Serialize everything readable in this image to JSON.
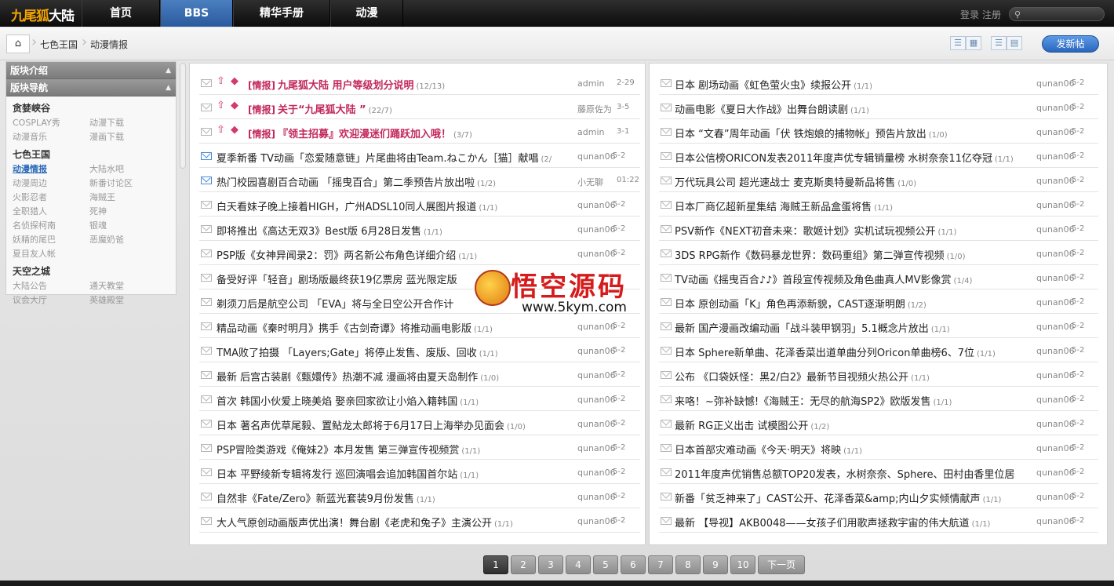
{
  "header": {
    "logo_a": "九尾狐",
    "logo_b": "大陆",
    "nav": [
      "首页",
      "BBS",
      "精华手册",
      "动漫"
    ],
    "login": "登录",
    "register": "注册",
    "search_placeholder": ""
  },
  "breadcrumb": {
    "home_icon": "home-icon",
    "items": [
      "七色王国",
      "动漫情报"
    ],
    "post_button": "发新帖"
  },
  "sidebar": {
    "intro_title": "版块介绍",
    "nav_title": "版块导航",
    "groups": [
      {
        "title": "贪婪峡谷",
        "items": [
          "COSPLAY秀",
          "动漫下载",
          "动漫音乐",
          "漫画下载"
        ]
      },
      {
        "title": "七色王国",
        "items": [
          "动漫情报",
          "大陆水吧",
          "动漫周边",
          "新番讨论区",
          "火影忍者",
          "海贼王",
          "全职猎人",
          "死神",
          "名侦探柯南",
          "银魂",
          "妖精的尾巴",
          "恶魔奶爸",
          "夏目友人帐"
        ]
      },
      {
        "title": "天空之城",
        "items": [
          "大陆公告",
          "通天教堂",
          "议会大厅",
          "英雄殿堂"
        ]
      }
    ]
  },
  "threads_left": [
    {
      "prefix": "[情报]",
      "title": "九尾狐大陆 用户等级划分说明",
      "count": "(12/13)",
      "author": "admin",
      "date": "2-29",
      "hot": true
    },
    {
      "prefix": "[情报]",
      "title": "关于“九尾狐大陆 ”",
      "count": "(22/7)",
      "author": "藤原佐为",
      "date": "3-5",
      "hot": true
    },
    {
      "prefix": "[情报]",
      "title": "『领主招募』欢迎漫迷们踊跃加入哦！",
      "count": "(3/7)",
      "author": "admin",
      "date": "3-1",
      "hot": true
    },
    {
      "prefix": "",
      "title": "夏季新番 TV动画「恋爱随意链」片尾曲将由Team.ねこかん［猫］献唱",
      "count": "(2/",
      "author": "qunan06",
      "date": "5-2",
      "hot": false
    },
    {
      "prefix": "",
      "title": "热门校园喜剧百合动画 「摇曳百合」第二季预告片放出啦",
      "count": "(1/2)",
      "author": "小无聊",
      "date": "01:22",
      "hot": false
    },
    {
      "prefix": "",
      "title": "白天看妹子晚上接着HIGH，广州ADSL10同人展图片报道",
      "count": "(1/1)",
      "author": "qunan06",
      "date": "5-2",
      "hot": false
    },
    {
      "prefix": "",
      "title": "即将推出《高达无双3》Best版 6月28日发售",
      "count": "(1/1)",
      "author": "qunan06",
      "date": "5-2",
      "hot": false
    },
    {
      "prefix": "",
      "title": "PSP版《女神异闻录2：罚》两名新公布角色详细介绍",
      "count": "(1/1)",
      "author": "qunan06",
      "date": "5-2",
      "hot": false
    },
    {
      "prefix": "",
      "title": "备受好评「轻音」剧场版最终获19亿票房 蓝光限定版",
      "count": "",
      "author": "",
      "date": "",
      "hot": false
    },
    {
      "prefix": "",
      "title": "剃须刀后是航空公司 「EVA」将与全日空公开合作计",
      "count": "",
      "author": "",
      "date": "",
      "hot": false
    },
    {
      "prefix": "",
      "title": "精品动画《秦时明月》携手《古剑奇谭》将推动画电影版",
      "count": "(1/1)",
      "author": "qunan06",
      "date": "5-2",
      "hot": false
    },
    {
      "prefix": "",
      "title": "TMA败了拍摄 「Layers;Gate」将停止发售、废版、回收",
      "count": "(1/1)",
      "author": "qunan06",
      "date": "5-2",
      "hot": false
    },
    {
      "prefix": "",
      "title": "最新 后宫古装剧《甄嬛传》热潮不减 漫画将由夏天岛制作",
      "count": "(1/0)",
      "author": "qunan06",
      "date": "5-2",
      "hot": false
    },
    {
      "prefix": "",
      "title": "首次 韩国小伙爱上晓美焰 娶亲回家欲让小焰入籍韩国",
      "count": "(1/1)",
      "author": "qunan06",
      "date": "5-2",
      "hot": false
    },
    {
      "prefix": "",
      "title": "日本 著名声优草尾毅、置鲇龙太郎将于6月17日上海举办见面会",
      "count": "(1/0)",
      "author": "qunan06",
      "date": "5-2",
      "hot": false
    },
    {
      "prefix": "",
      "title": "PSP冒险类游戏《俺妹2》本月发售 第三弹宣传视频赏",
      "count": "(1/1)",
      "author": "qunan06",
      "date": "5-2",
      "hot": false
    },
    {
      "prefix": "",
      "title": "日本 平野绫新专辑将发行 巡回演唱会追加韩国首尔站",
      "count": "(1/1)",
      "author": "qunan06",
      "date": "5-2",
      "hot": false
    },
    {
      "prefix": "",
      "title": "自然非《Fate/Zero》新蓝光套装9月份发售",
      "count": "(1/1)",
      "author": "qunan06",
      "date": "5-2",
      "hot": false
    },
    {
      "prefix": "",
      "title": "大人气原创动画版声优出演！舞台剧《老虎和兔子》主演公开",
      "count": "(1/1)",
      "author": "qunan06",
      "date": "5-2",
      "hot": false
    }
  ],
  "threads_right": [
    {
      "title": "日本 剧场动画《虹色萤火虫》续报公开",
      "count": "(1/1)",
      "author": "qunan06",
      "date": "5-2"
    },
    {
      "title": "动画电影《夏日大作战》出舞台朗读剧",
      "count": "(1/1)",
      "author": "qunan06",
      "date": "5-2"
    },
    {
      "title": "日本 “文春”周年动画「伏 铁炮娘的捕物帐」预告片放出",
      "count": "(1/0)",
      "author": "qunan06",
      "date": "5-2"
    },
    {
      "title": "日本公信榜ORICON发表2011年度声优专辑销量榜 水树奈奈11亿夺冠",
      "count": "(1/1)",
      "author": "qunan06",
      "date": "5-2"
    },
    {
      "title": "万代玩具公司 超光速战士 麦克斯奥特曼新品将售",
      "count": "(1/0)",
      "author": "qunan06",
      "date": "5-2"
    },
    {
      "title": "日本厂商亿超新星集结 海贼王新品盒蛋将售",
      "count": "(1/1)",
      "author": "qunan06",
      "date": "5-2"
    },
    {
      "title": "PSV新作《NEXT初音未来：歌姬计划》实机试玩视频公开",
      "count": "(1/1)",
      "author": "qunan06",
      "date": "5-2"
    },
    {
      "title": "3DS RPG新作《数码暴龙世界：数码重组》第二弹宣传视频",
      "count": "(1/0)",
      "author": "qunan06",
      "date": "5-2"
    },
    {
      "title": "TV动画《摇曳百合♪♪》首段宣传视频及角色曲真人MV影像赏",
      "count": "(1/4)",
      "author": "qunan06",
      "date": "5-2"
    },
    {
      "title": "日本 原创动画「K」角色再添新貌，CAST逐渐明朗",
      "count": "(1/2)",
      "author": "qunan06",
      "date": "5-2"
    },
    {
      "title": "最新 国产漫画改编动画「战斗装甲钢羽」5.1概念片放出",
      "count": "(1/1)",
      "author": "qunan06",
      "date": "5-2"
    },
    {
      "title": "日本 Sphere新单曲、花泽香菜出道单曲分列Oricon单曲榜6、7位",
      "count": "(1/1)",
      "author": "qunan06",
      "date": "5-2"
    },
    {
      "title": "公布 《口袋妖怪：黑2/白2》最新节目视频火热公开",
      "count": "(1/1)",
      "author": "qunan06",
      "date": "5-2"
    },
    {
      "title": "来咯！~弥补缺憾!《海贼王：无尽的航海SP2》欧版发售",
      "count": "(1/1)",
      "author": "qunan06",
      "date": "5-2"
    },
    {
      "title": "最新 RG正义出击 试模图公开",
      "count": "(1/2)",
      "author": "qunan06",
      "date": "5-2"
    },
    {
      "title": "日本首部灾难动画《今天·明天》将映",
      "count": "(1/1)",
      "author": "qunan06",
      "date": "5-2"
    },
    {
      "title": "2011年度声优销售总额TOP20发表，水树奈奈、Sphere、田村由香里位居",
      "count": "",
      "author": "qunan06",
      "date": "5-2"
    },
    {
      "title": "新番「贫乏神来了」CAST公开、花泽香菜&amp;内山夕实倾情献声",
      "count": "(1/1)",
      "author": "qunan06",
      "date": "5-2"
    },
    {
      "title": "最新 【导视】AKB0048——女孩子们用歌声拯救宇宙的伟大航道",
      "count": "(1/1)",
      "author": "qunan06",
      "date": "5-2"
    }
  ],
  "watermark": {
    "text": "悟空源码",
    "url": "www.5kym.com"
  },
  "pager": {
    "pages": [
      "1",
      "2",
      "3",
      "4",
      "5",
      "6",
      "7",
      "8",
      "9",
      "10"
    ],
    "next": "下一页",
    "current": "1"
  }
}
